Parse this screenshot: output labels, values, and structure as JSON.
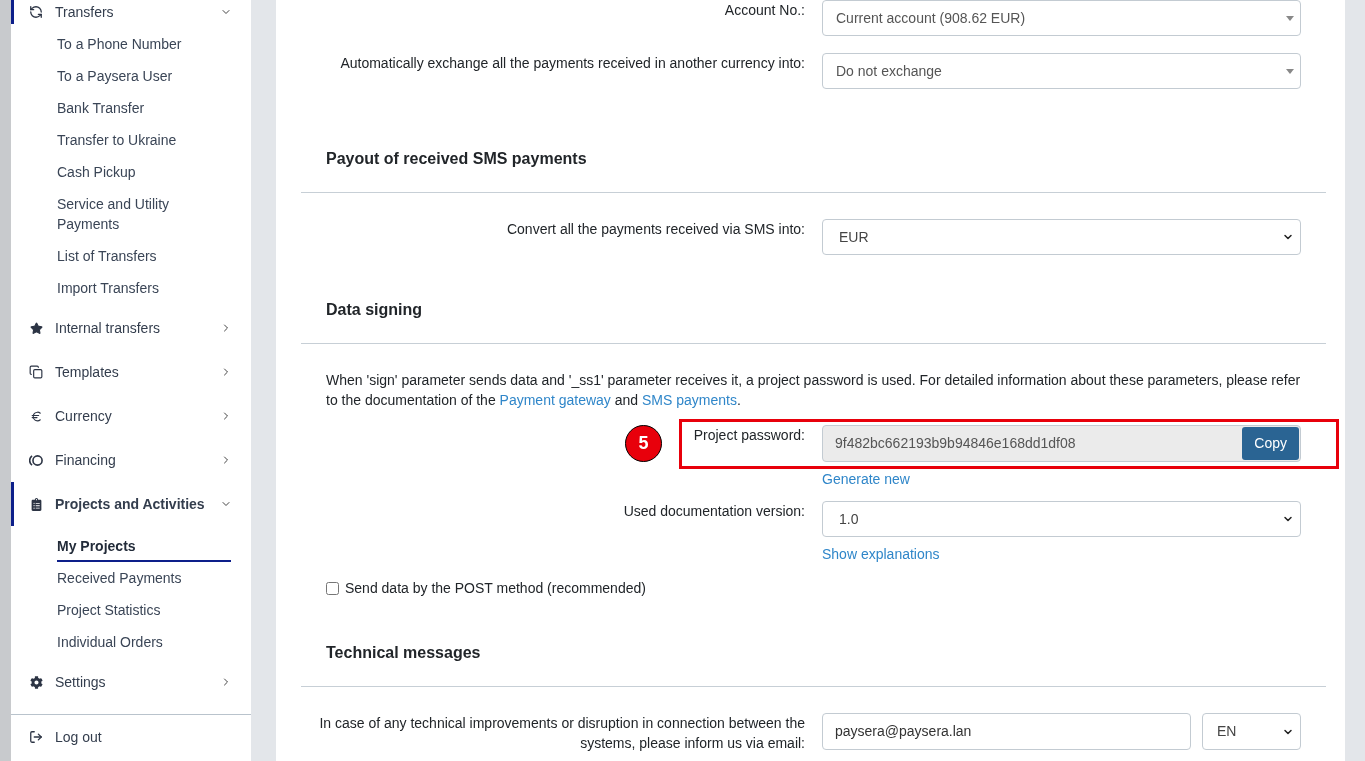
{
  "sidebar": {
    "items": [
      {
        "label": "Transfers",
        "expanded": true,
        "selected": false,
        "children": [
          {
            "label": "To a Phone Number",
            "selected": false
          },
          {
            "label": "To a Paysera User",
            "selected": false
          },
          {
            "label": "Bank Transfer",
            "selected": false
          },
          {
            "label": "Transfer to Ukraine",
            "selected": false
          },
          {
            "label": "Cash Pickup",
            "selected": false
          },
          {
            "label": "Service and Utility Payments",
            "selected": false
          },
          {
            "label": "List of Transfers",
            "selected": false
          },
          {
            "label": "Import Transfers",
            "selected": false
          }
        ]
      },
      {
        "label": "Internal transfers",
        "expanded": false,
        "selected": false
      },
      {
        "label": "Templates",
        "expanded": false,
        "selected": false
      },
      {
        "label": "Currency",
        "expanded": false,
        "selected": false
      },
      {
        "label": "Financing",
        "expanded": false,
        "selected": false
      },
      {
        "label": "Projects and Activities",
        "expanded": true,
        "selected": true,
        "children": [
          {
            "label": "My Projects",
            "selected": true
          },
          {
            "label": "Received Payments",
            "selected": false
          },
          {
            "label": "Project Statistics",
            "selected": false
          },
          {
            "label": "Individual Orders",
            "selected": false
          }
        ]
      },
      {
        "label": "Settings",
        "expanded": false,
        "selected": false
      }
    ],
    "logout": "Log out"
  },
  "main": {
    "sections": [
      {
        "rows": [
          {
            "kind": "combo",
            "label": "Account No.:",
            "value": "Current account (908.62 EUR)"
          },
          {
            "kind": "combo",
            "label": "Automatically exchange all the payments received in another currency into:",
            "value": "Do not exchange"
          }
        ]
      },
      {
        "heading": "Payout of received SMS payments",
        "rows": [
          {
            "kind": "select",
            "label": "Convert all the payments received via SMS into:",
            "value": "EUR"
          }
        ]
      },
      {
        "heading": "Data signing",
        "intro": [
          {
            "kind": "text",
            "text": "When 'sign' parameter sends data and '_ss1' parameter receives it, a project password is used. For detailed information about these parameters, please refer to the documentation of the "
          },
          {
            "kind": "link",
            "text": "Payment gateway"
          },
          {
            "kind": "text",
            "text": " and "
          },
          {
            "kind": "link",
            "text": "SMS payments"
          },
          {
            "kind": "text",
            "text": "."
          }
        ],
        "rows": [
          {
            "kind": "password",
            "label": "Project password:",
            "value": "9f482bc662193b9b94846e168dd1df08",
            "button": "Copy",
            "link": "Generate new",
            "annotation": "5"
          },
          {
            "kind": "select",
            "label": "Used documentation version:",
            "value": "1.0",
            "link": "Show explanations"
          },
          {
            "kind": "checkbox",
            "label": "Send data by the POST method (recommended)",
            "checked": false
          }
        ]
      },
      {
        "heading": "Technical messages",
        "rows": [
          {
            "kind": "email",
            "label": "In case of any technical improvements or disruption in connection between the systems, please inform us via email:",
            "value": "paysera@paysera.lan",
            "language": "EN"
          }
        ]
      }
    ]
  }
}
